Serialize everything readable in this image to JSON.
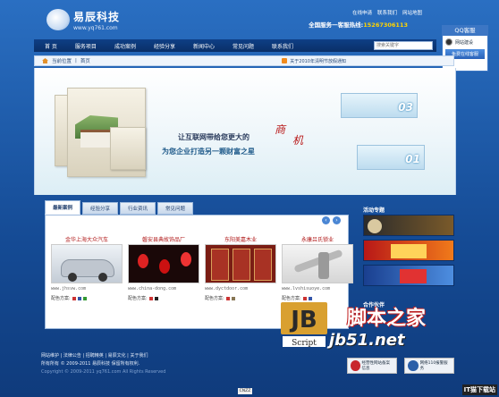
{
  "header": {
    "logo_text": "易辰科技",
    "logo_url": "www.yq761.com",
    "top_links": [
      "在线申请",
      "联系我们",
      "网站地图"
    ],
    "hotline_label": "全国服务一客服热线:",
    "hotline_number": "15267306113"
  },
  "nav": {
    "items": [
      "首 页",
      "服务项目",
      "成功案例",
      "经验分享",
      "新闻中心",
      "常见问题",
      "联系我们"
    ],
    "search_placeholder": "搜索关键字"
  },
  "qq_panel": {
    "title": "QQ客服",
    "row_label": "网站建设",
    "button_label": "免费在线客服"
  },
  "breadcrumb": {
    "label": "当前位置",
    "current": "首页",
    "notice": "关于2010年清明节放假通知"
  },
  "banner": {
    "line1": "让互联网带给您更大的",
    "line2": "为您企业打造另一颗财富之星",
    "accent1": "商",
    "accent2": "机",
    "num1": "03",
    "num2": "01",
    "colors": {
      "accent_red": "#b91b1b",
      "nav_bg": "#0e3f86",
      "page_bg": "#1b4f9a"
    }
  },
  "tabs": [
    "最新案例",
    "经验分享",
    "行业资讯",
    "常见问题"
  ],
  "products": [
    {
      "title": "金华上海大众汽车",
      "url": "www.jhsvw.com",
      "colors_label": "配色方案:"
    },
    {
      "title": "磐安县典故饰品厂",
      "url": "www.china-dong.com",
      "colors_label": "配色方案:"
    },
    {
      "title": "东阳美嘉木业",
      "url": "www.dyctdoor.com",
      "colors_label": "配色方案:"
    },
    {
      "title": "永康吕氏锁业",
      "url": "www.lvshisuoye.com",
      "colors_label": "配色方案:"
    }
  ],
  "side": {
    "title": "活动专题",
    "title2": "合作伙伴"
  },
  "footer": {
    "links": "网站维护 | 法律公告 | 招聘精英 | 易辰文化 | 关于我们",
    "copyright": "所有所有 © 2009-2011 易辰科技 保留所有权利.",
    "copyright_en": "Copyright © 2009-2011 yq761.com All Rights Reserved"
  },
  "badges": [
    "经营性网站备案信息",
    "网络110报警服务"
  ],
  "watermark": {
    "logo_letters": "JB",
    "logo_sub": "Script",
    "site_cn": "脚本之家",
    "site_url": "jb51.net",
    "corner": "IT猫下载站",
    "cnzz": "CNZZ"
  }
}
